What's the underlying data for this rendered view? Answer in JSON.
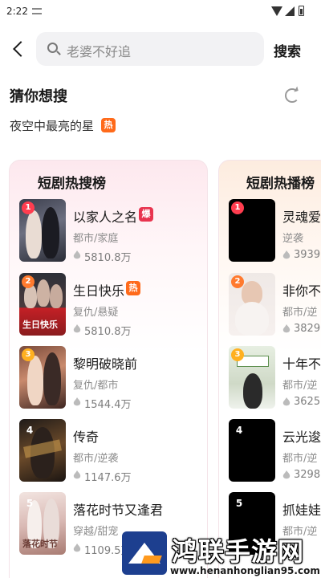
{
  "status_bar": {
    "time": "2:22"
  },
  "search": {
    "placeholder": "老婆不好追",
    "button_label": "搜索"
  },
  "guess": {
    "title": "猜你想搜",
    "items": [
      {
        "label": "夜空中最亮的星",
        "badge": "热"
      }
    ]
  },
  "panels": [
    {
      "title": "短剧热搜榜",
      "items": [
        {
          "rank": "1",
          "name": "以家人之名",
          "badge": "爆",
          "tags": "都市/家庭",
          "heat": "5810.8万"
        },
        {
          "rank": "2",
          "name": "生日快乐",
          "badge": "热",
          "tags": "复仇/悬疑",
          "heat": "5810.8万"
        },
        {
          "rank": "3",
          "name": "黎明破晓前",
          "badge": "",
          "tags": "复仇/都市",
          "heat": "1544.4万"
        },
        {
          "rank": "4",
          "name": "传奇",
          "badge": "",
          "tags": "都市/逆袭",
          "heat": "1147.6万"
        },
        {
          "rank": "5",
          "name": "落花时节又逢君",
          "badge": "",
          "tags": "穿越/甜宠",
          "heat": "1109.5万"
        }
      ]
    },
    {
      "title": "短剧热播榜",
      "items": [
        {
          "rank": "1",
          "name": "灵魂爱",
          "tags": "逆袭",
          "heat": "3939"
        },
        {
          "rank": "2",
          "name": "非你不",
          "tags": "都市/逆",
          "heat": "3829"
        },
        {
          "rank": "3",
          "name": "十年不",
          "tags": "都市/逆",
          "heat": "3625"
        },
        {
          "rank": "4",
          "name": "云光逡",
          "tags": "都市/逆",
          "heat": "3298"
        },
        {
          "rank": "5",
          "name": "抓娃娃",
          "tags": "都市/逆",
          "heat": ""
        }
      ]
    }
  ],
  "poster_texts": {
    "p2": "生日快乐",
    "p5": "落花时节"
  },
  "watermark": {
    "title": "鸿联手游网",
    "url": "www.henanhonglian95.com"
  },
  "colors": {
    "hot_badge": "#ff6a1a",
    "explode_badge": "#e8344f",
    "rank1": "#ff3d4f",
    "rank2": "#ff7a2e",
    "rank3": "#ffb020",
    "watermark_blue": "#1d3f8f"
  }
}
